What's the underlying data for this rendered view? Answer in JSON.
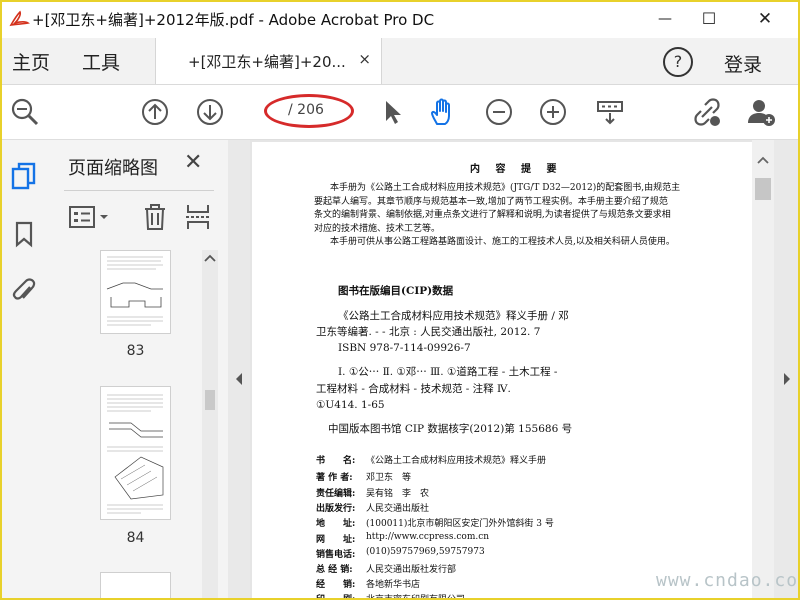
{
  "window": {
    "title": "+[邓卫东+编著]+2012年版.pdf - Adobe Acrobat Pro DC",
    "minimize_label": "—",
    "maximize_label": "☐",
    "close_label": "✕"
  },
  "tabs": {
    "home": "主页",
    "tools": "工具",
    "document": "+[邓卫东+编著]+20...",
    "close": "×",
    "help": "?",
    "login": "登录"
  },
  "toolbar": {
    "page_indicator": "/ 206",
    "accent_color": "#1473e6",
    "highlight_color": "#d62a2a"
  },
  "panel": {
    "title": "页面缩略图",
    "close": "✕",
    "thumbnails": [
      {
        "label": "83"
      },
      {
        "label": "84"
      }
    ]
  },
  "page": {
    "heading": "内 容 提 要",
    "summary": [
      "本手册为《公路土工合成材料应用技术规范》(JTG/T D32—2012)的配套图书,由规范主",
      "要起草人编写。其章节顺序与规范基本一致,增加了两节工程实例。本手册主要介绍了规范",
      "条文的编制背景、编制依据,对重点条文进行了解释和说明,为读者提供了与规范条文要求相",
      "对应的技术措施、技术工艺等。",
      "本手册可供从事公路工程路基路面设计、施工的工程技术人员,以及相关科研人员使用。"
    ],
    "cip_title": "图书在版编目(CIP)数据",
    "cip_lines": [
      "《公路土工合成材料应用技术规范》释义手册 / 邓",
      "卫东等编著. - - 北京 : 人民交通出版社, 2012. 7",
      "ISBN 978-7-114-09926-7",
      "Ⅰ. ①公⋯ Ⅱ. ①邓⋯ Ⅲ. ①道路工程 - 土木工程 -",
      "工程材料 - 合成材料 - 技术规范 - 注释 Ⅳ.",
      "①U414. 1-65"
    ],
    "cip_record": "中国版本图书馆 CIP 数据核字(2012)第 155686 号",
    "info": [
      {
        "k": "书　　名:",
        "v": "《公路土工合成材料应用技术规范》释义手册"
      },
      {
        "k": "著 作 者:",
        "v": "邓卫东　等"
      },
      {
        "k": "责任编辑:",
        "v": "吴有铭　李　农"
      },
      {
        "k": "出版发行:",
        "v": "人民交通出版社"
      },
      {
        "k": "地　　址:",
        "v": "(100011)北京市朝阳区安定门外外馆斜街 3 号"
      },
      {
        "k": "网　　址:",
        "v": "http://www.ccpress.com.cn"
      },
      {
        "k": "销售电话:",
        "v": "(010)59757969,59757973"
      },
      {
        "k": "总 经 销:",
        "v": "人民交通出版社发行部"
      },
      {
        "k": "经　　销:",
        "v": "各地新华书店"
      },
      {
        "k": "印　　刷:",
        "v": "北京市密东印刷有限公司"
      }
    ]
  },
  "watermark": "www.cndao.com"
}
